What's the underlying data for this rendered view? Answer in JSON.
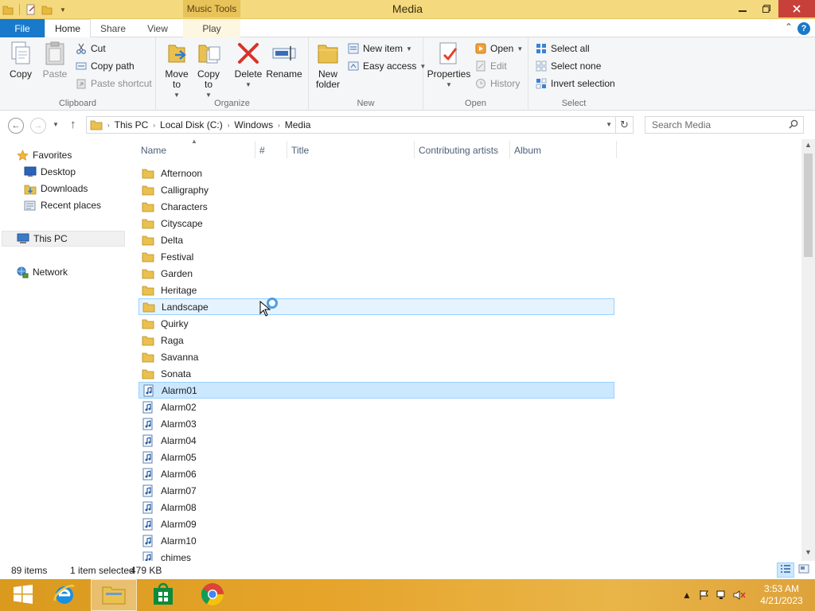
{
  "titlebar": {
    "context_tab_header": "Music Tools",
    "window_title": "Media"
  },
  "ribbon_tabs": {
    "file": "File",
    "home": "Home",
    "share": "Share",
    "view": "View",
    "play": "Play"
  },
  "ribbon": {
    "clipboard": {
      "label": "Clipboard",
      "copy": "Copy",
      "paste": "Paste",
      "cut": "Cut",
      "copy_path": "Copy path",
      "paste_shortcut": "Paste shortcut"
    },
    "organize": {
      "label": "Organize",
      "move_to": "Move to",
      "copy_to": "Copy to",
      "delete": "Delete",
      "rename": "Rename"
    },
    "new": {
      "label": "New",
      "new_folder": "New folder",
      "new_item": "New item",
      "easy_access": "Easy access"
    },
    "open": {
      "label": "Open",
      "properties": "Properties",
      "open": "Open",
      "edit": "Edit",
      "history": "History"
    },
    "select": {
      "label": "Select",
      "select_all": "Select all",
      "select_none": "Select none",
      "invert_selection": "Invert selection"
    }
  },
  "address": {
    "crumbs": [
      "This PC",
      "Local Disk (C:)",
      "Windows",
      "Media"
    ],
    "search_placeholder": "Search Media"
  },
  "nav_pane": {
    "favorites": "Favorites",
    "desktop": "Desktop",
    "downloads": "Downloads",
    "recent_places": "Recent places",
    "this_pc": "This PC",
    "network": "Network"
  },
  "columns": {
    "name": "Name",
    "number": "#",
    "title": "Title",
    "contributing_artists": "Contributing artists",
    "album": "Album"
  },
  "files": [
    {
      "name": "Afternoon",
      "type": "folder"
    },
    {
      "name": "Calligraphy",
      "type": "folder"
    },
    {
      "name": "Characters",
      "type": "folder"
    },
    {
      "name": "Cityscape",
      "type": "folder"
    },
    {
      "name": "Delta",
      "type": "folder"
    },
    {
      "name": "Festival",
      "type": "folder"
    },
    {
      "name": "Garden",
      "type": "folder"
    },
    {
      "name": "Heritage",
      "type": "folder"
    },
    {
      "name": "Landscape",
      "type": "folder"
    },
    {
      "name": "Quirky",
      "type": "folder"
    },
    {
      "name": "Raga",
      "type": "folder"
    },
    {
      "name": "Savanna",
      "type": "folder"
    },
    {
      "name": "Sonata",
      "type": "folder"
    },
    {
      "name": "Alarm01",
      "type": "audio"
    },
    {
      "name": "Alarm02",
      "type": "audio"
    },
    {
      "name": "Alarm03",
      "type": "audio"
    },
    {
      "name": "Alarm04",
      "type": "audio"
    },
    {
      "name": "Alarm05",
      "type": "audio"
    },
    {
      "name": "Alarm06",
      "type": "audio"
    },
    {
      "name": "Alarm07",
      "type": "audio"
    },
    {
      "name": "Alarm08",
      "type": "audio"
    },
    {
      "name": "Alarm09",
      "type": "audio"
    },
    {
      "name": "Alarm10",
      "type": "audio"
    },
    {
      "name": "chimes",
      "type": "audio"
    }
  ],
  "status": {
    "item_count": "89 items",
    "selection": "1 item selected",
    "size": "479 KB"
  },
  "taskbar": {
    "time": "3:53 AM",
    "date": "4/21/2023"
  },
  "colors": {
    "titlebar": "#f4d97e",
    "file_tab": "#1979ca",
    "selection": "#cce8ff",
    "selection_border": "#99d1ff",
    "close_button": "#c7413a"
  }
}
